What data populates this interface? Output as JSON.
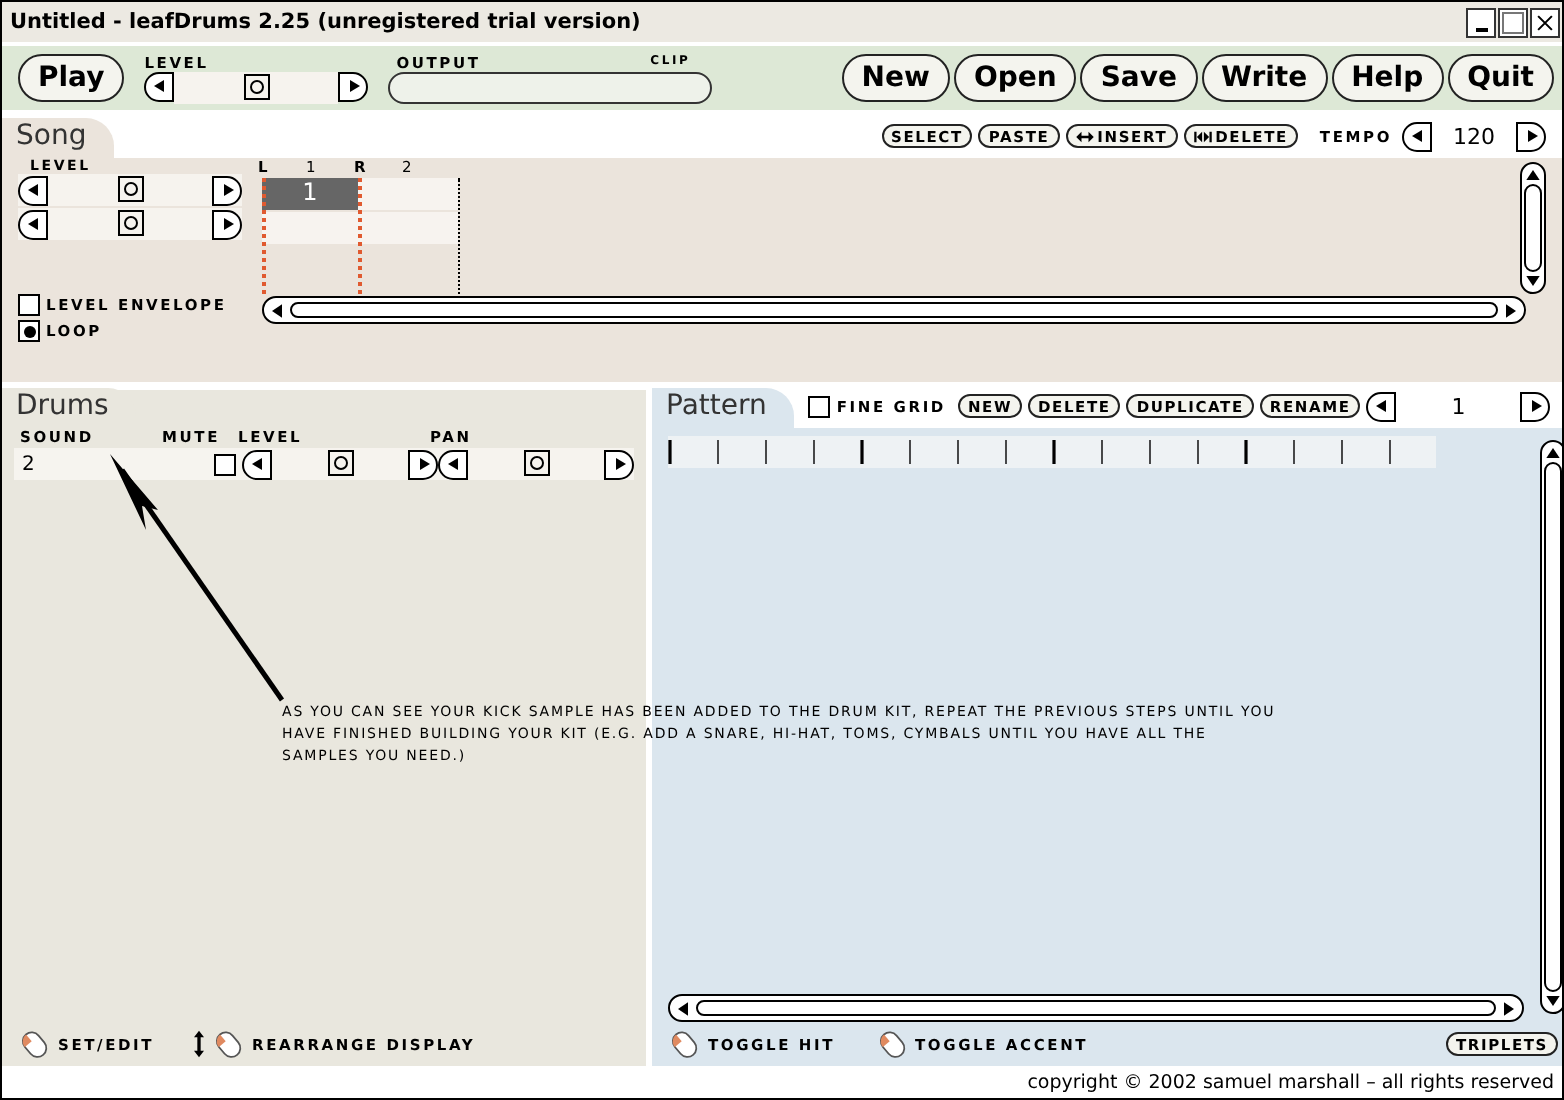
{
  "window": {
    "title": "Untitled - leafDrums 2.25 (unregistered trial version)"
  },
  "toolbar": {
    "play": "Play",
    "level_label": "LEVEL",
    "level": 0.5,
    "output_label": "OUTPUT",
    "clip_label": "CLIP",
    "buttons": [
      "New",
      "Open",
      "Save",
      "Write",
      "Help",
      "Quit"
    ]
  },
  "song": {
    "tab": "Song",
    "buttons": [
      {
        "label": "SELECT",
        "kind": "plain"
      },
      {
        "label": "PASTE",
        "kind": "plain"
      },
      {
        "label": "INSERT",
        "kind": "insert"
      },
      {
        "label": "DELETE",
        "kind": "delete"
      }
    ],
    "tempo_label": "TEMPO",
    "tempo": "120",
    "level_label": "LEVEL",
    "markers": [
      {
        "label": "L",
        "kind": "loop"
      },
      {
        "label": "1",
        "kind": "bar"
      },
      {
        "label": "R",
        "kind": "loop"
      },
      {
        "label": "2",
        "kind": "bar"
      }
    ],
    "tracks": [
      {
        "level": 0.5,
        "blocks": [
          {
            "label": "1",
            "selected": true
          },
          {
            "selected": false
          }
        ]
      },
      {
        "level": 0.5,
        "blocks": [
          {
            "selected": false
          },
          {
            "selected": false
          }
        ]
      }
    ],
    "options": [
      {
        "label": "LEVEL ENVELOPE",
        "checked": false
      },
      {
        "label": "LOOP",
        "checked": true
      }
    ]
  },
  "drums": {
    "tab": "Drums",
    "columns": [
      "SOUND",
      "MUTE",
      "LEVEL",
      "PAN"
    ],
    "rows": [
      {
        "sound": "2",
        "mute": false,
        "level": 0.5,
        "pan": {
          "level": 0.5
        }
      }
    ],
    "hints": [
      {
        "label": "SET/EDIT",
        "kind": "mouse"
      },
      {
        "label": "REARRANGE DISPLAY",
        "kind": "drag"
      }
    ]
  },
  "note": "AS YOU CAN SEE YOUR KICK SAMPLE HAS BEEN ADDED TO THE DRUM KIT, REPEAT THE PREVIOUS STEPS UNTIL YOU HAVE FINISHED BUILDING YOUR KIT (E.G. ADD A SNARE, HI-HAT, TOMS, CYMBALS UNTIL YOU HAVE ALL THE SAMPLES YOU NEED.)",
  "pattern": {
    "tab": "Pattern",
    "fine_grid": {
      "label": "FINE GRID",
      "checked": false
    },
    "buttons": [
      "NEW",
      "DELETE",
      "DUPLICATE",
      "RENAME"
    ],
    "number": "1",
    "hints": [
      {
        "label": "TOGGLE HIT",
        "kind": "mouse"
      },
      {
        "label": "TOGGLE ACCENT",
        "kind": "mouse"
      }
    ],
    "triplets": "TRIPLETS"
  },
  "footer": "copyright © 2002 samuel marshall – all rights reserved"
}
